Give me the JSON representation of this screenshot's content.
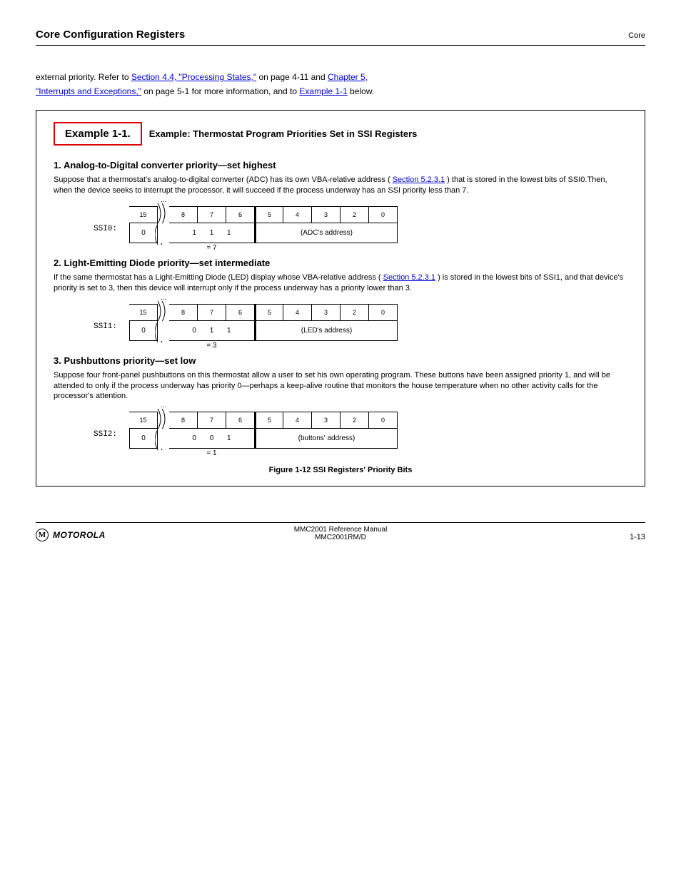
{
  "header": {
    "title": "Core Configuration Registers",
    "sub": "Core"
  },
  "intro": {
    "line1_prefix": "external priority. Refer to ",
    "line1_link": "Section 4.4, \"Processing States,\"",
    "line1_rest": " on page 4-11 and ",
    "line1_link2": "Chapter 5, ",
    "line2_link": "\"Interrupts and Exceptions,\"",
    "line2_rest": " on page 5-1 for more information, and to ",
    "line2_link2": "Example 1-1",
    "line2_rest2": " below."
  },
  "example": {
    "label": "Example 1-1.",
    "title": "Example: Thermostat Program Priorities Set in SSI Registers"
  },
  "sec1": {
    "head": "1. Analog-to-Digital converter priority—set highest",
    "text_pre": "Suppose that a thermostat's analog-to-digital converter (ADC) has its own VBA-relative address (",
    "text_link": "Section 5.2.3.1",
    "text_rest": ") that is stored in the lowest bits of SSI0.Then, when the device seeks to interrupt the processor, it will succeed if the process underway has an SSI priority less than 7."
  },
  "reg1": {
    "label": "SSI0:",
    "bits": [
      "15",
      "8",
      "7",
      "6",
      "5",
      "4",
      "3",
      "2",
      "0"
    ],
    "ellipsis": "...",
    "val_left": "0",
    "val_mid": "1 1 1",
    "val_mid_text": "= 7",
    "val_right": "(ADC's address)"
  },
  "sec2": {
    "head": "2. Light-Emitting Diode priority—set intermediate",
    "text_pre": "If the same thermostat has a Light-Emitting Diode (LED) display whose VBA-relative address (",
    "text_link": "Section 5.2.3.1",
    "text_rest": ") is stored in the lowest bits of SSI1, and that device's priority is set to 3, then this device will interrupt only if the process underway has a priority lower than 3."
  },
  "reg2": {
    "label": "SSI1:",
    "bits": [
      "15",
      "8",
      "7",
      "6",
      "5",
      "4",
      "3",
      "2",
      "0"
    ],
    "ellipsis": "...",
    "val_left": "0",
    "val_mid": "0 1 1",
    "val_mid_text": "= 3",
    "val_right": "(LED's address)"
  },
  "sec3": {
    "head": "3. Pushbuttons priority—set low",
    "text": "Suppose four front-panel pushbuttons on this thermostat allow a user to set his own operating program. These buttons have been assigned priority 1, and will be attended to only if the process underway has priority 0—perhaps a keep-alive routine that monitors the house temperature when no other activity calls for the processor's attention."
  },
  "reg3": {
    "label": "SSI2:",
    "bits": [
      "15",
      "8",
      "7",
      "6",
      "5",
      "4",
      "3",
      "2",
      "0"
    ],
    "ellipsis": "...",
    "val_left": "0",
    "val_mid": "0 0 1",
    "val_mid_text": "= 1",
    "val_right": "(buttons' address)"
  },
  "figure": {
    "caption": "Figure 1-12 SSI Registers' Priority Bits"
  },
  "footer": {
    "doc": "MMC2001 Reference Manual",
    "logo_text": "MOTOROLA",
    "manual_ref": "MMC2001RM/D",
    "page": "1-13"
  }
}
